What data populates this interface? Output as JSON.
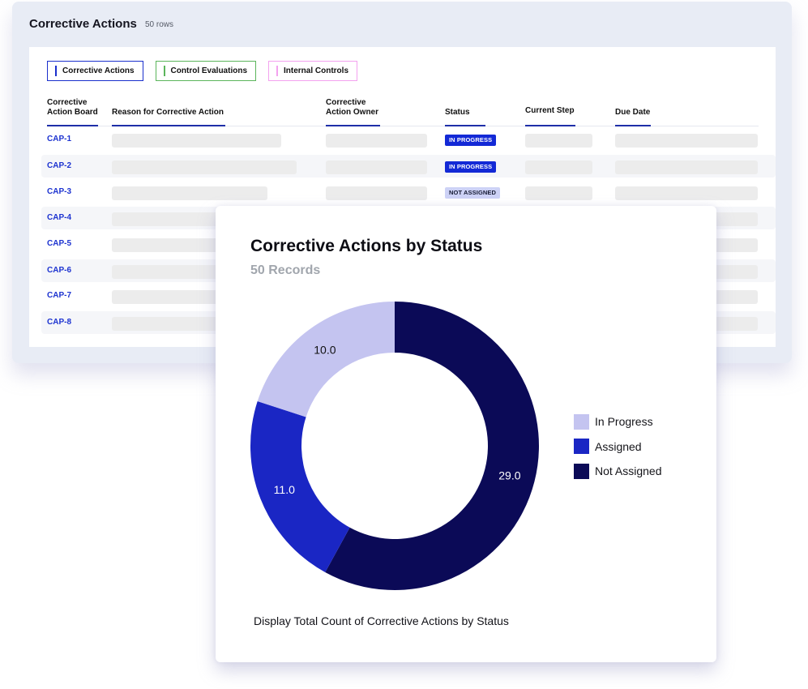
{
  "panel": {
    "title": "Corrective Actions",
    "count": "50 rows",
    "tabs": [
      {
        "label": "Corrective Actions",
        "color": "#1a2fcc"
      },
      {
        "label": "Control Evaluations",
        "color": "#5bb55b"
      },
      {
        "label": "Internal Controls",
        "color": "#f3a2ef"
      }
    ],
    "columns": [
      {
        "label_line1": "Corrective",
        "label_line2": "Action Board"
      },
      {
        "label_line1": "",
        "label_line2": "Reason for Corrective Action"
      },
      {
        "label_line1": "Corrective",
        "label_line2": "Action Owner"
      },
      {
        "label_line1": "",
        "label_line2": "Status"
      },
      {
        "label_line1": "",
        "label_line2": "Current Step"
      },
      {
        "label_line1": "",
        "label_line2": "Due Date"
      }
    ],
    "rows": [
      {
        "id": "CAP-1",
        "status": "IN PROGRESS"
      },
      {
        "id": "CAP-2",
        "status": "IN PROGRESS"
      },
      {
        "id": "CAP-3",
        "status": "NOT ASSIGNED"
      },
      {
        "id": "CAP-4",
        "status": ""
      },
      {
        "id": "CAP-5",
        "status": ""
      },
      {
        "id": "CAP-6",
        "status": ""
      },
      {
        "id": "CAP-7",
        "status": ""
      },
      {
        "id": "CAP-8",
        "status": ""
      }
    ]
  },
  "chart_card": {
    "title": "Corrective Actions by Status",
    "subtitle": "50 Records",
    "caption": "Display Total Count of Corrective Actions by Status"
  },
  "chart_data": {
    "type": "pie",
    "variant": "donut",
    "title": "Corrective Actions by Status",
    "subtitle": "50 Records",
    "categories": [
      "Not Assigned",
      "Assigned",
      "In Progress"
    ],
    "values": [
      29.0,
      11.0,
      10.0
    ],
    "data_labels": [
      "29.0",
      "11.0",
      "10.0"
    ],
    "colors": [
      "#0b0a57",
      "#1a26c4",
      "#c4c4f0"
    ],
    "label_colors": [
      "#ffffff",
      "#ffffff",
      "#111111"
    ],
    "start": "top, clockwise",
    "legend": {
      "position": "right",
      "entries": [
        {
          "label": "In Progress",
          "color": "#c4c4f0"
        },
        {
          "label": "Assigned",
          "color": "#1a26c4"
        },
        {
          "label": "Not Assigned",
          "color": "#0b0a57"
        }
      ]
    }
  }
}
